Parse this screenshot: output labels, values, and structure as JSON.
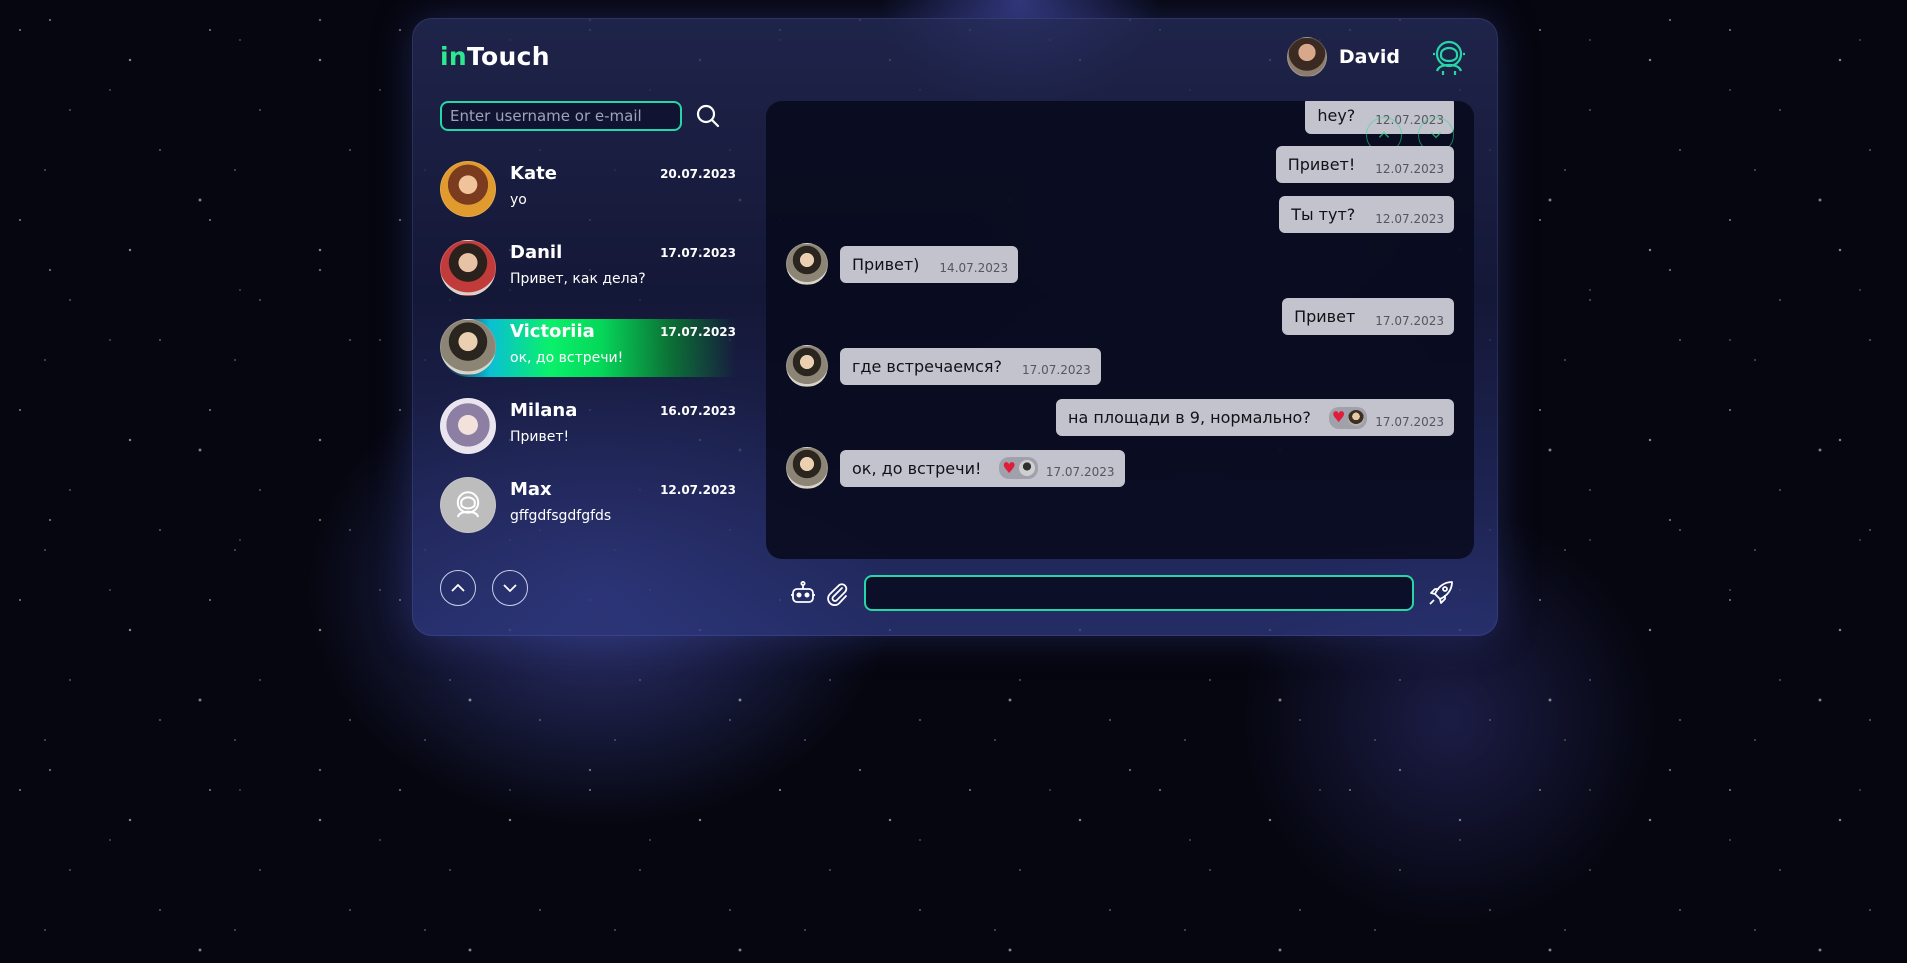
{
  "app": {
    "logo_in": "in",
    "logo_touch": "Touch",
    "user_name": "David"
  },
  "search": {
    "placeholder": "Enter username or e-mail",
    "value": ""
  },
  "contacts": [
    {
      "name": "Kate",
      "date": "20.07.2023",
      "last": "yo"
    },
    {
      "name": "Danil",
      "date": "17.07.2023",
      "last": "Привет, как дела?"
    },
    {
      "name": "Victoriia",
      "date": "17.07.2023",
      "last": "ок, до встречи!",
      "active": true
    },
    {
      "name": "Milana",
      "date": "16.07.2023",
      "last": "Привет!"
    },
    {
      "name": "Max",
      "date": "12.07.2023",
      "last": "gffgdfsgdfgfds"
    }
  ],
  "messages": [
    {
      "side": "right",
      "text": "hey?",
      "time": "12.07.2023"
    },
    {
      "side": "right",
      "text": "Привет!",
      "time": "12.07.2023"
    },
    {
      "side": "right",
      "text": "Ты тут?",
      "time": "12.07.2023"
    },
    {
      "side": "left",
      "text": "Привет)",
      "time": "14.07.2023"
    },
    {
      "side": "right",
      "text": "Привет",
      "time": "17.07.2023"
    },
    {
      "side": "left",
      "text": "где встречаемся?",
      "time": "17.07.2023"
    },
    {
      "side": "right",
      "text": "на площади в 9, нормально?",
      "time": "17.07.2023",
      "reaction": "heart"
    },
    {
      "side": "left",
      "text": "ок, до встречи!",
      "time": "17.07.2023",
      "reaction": "heart"
    }
  ],
  "composer": {
    "placeholder": "",
    "value": ""
  },
  "icons": {
    "search": "search-icon",
    "astronaut": "astronaut-icon",
    "bot": "robot-icon",
    "attach": "paperclip-icon",
    "send": "rocket-icon",
    "up": "chevron-up-icon",
    "down": "chevron-down-icon"
  },
  "colors": {
    "accent": "#26d6a8",
    "brand_green": "#2ee88f",
    "bubble": "#c2c3cc",
    "heart": "#e31b3a"
  }
}
